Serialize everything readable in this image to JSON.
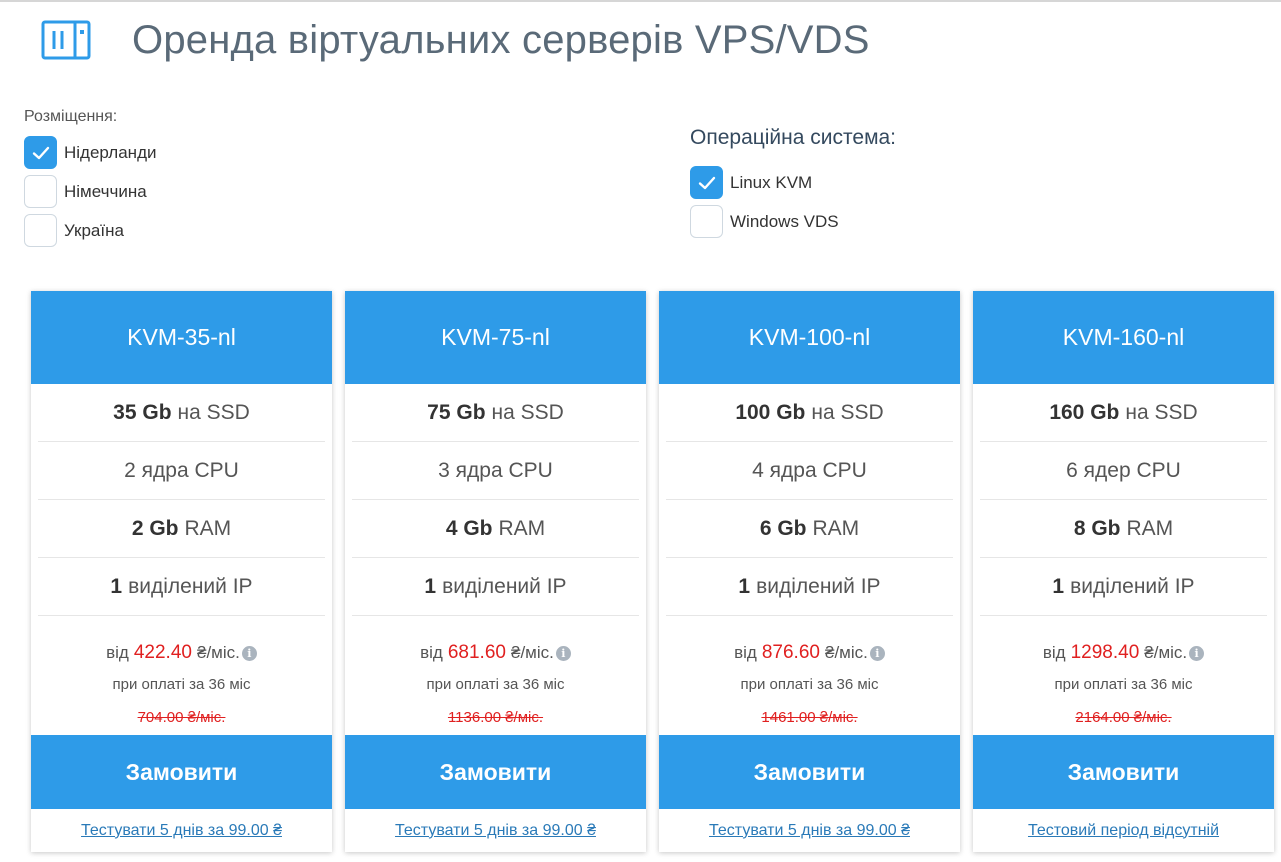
{
  "page": {
    "title": "Оренда віртуальних серверів VPS/VDS",
    "icon": "server-icon",
    "accent_color": "#2e9be8",
    "price_color": "#e02020"
  },
  "location_filter": {
    "title": "Розміщення:",
    "options": [
      {
        "label": "Нідерланди",
        "checked": true
      },
      {
        "label": "Німеччина",
        "checked": false
      },
      {
        "label": "Україна",
        "checked": false
      }
    ]
  },
  "os_filter": {
    "title": "Операційна система:",
    "options": [
      {
        "label": "Linux KVM",
        "checked": true
      },
      {
        "label": "Windows VDS",
        "checked": false
      }
    ]
  },
  "plans": [
    {
      "name": "KVM-35-nl",
      "ssd_value": "35 Gb",
      "ssd_unit": "на SSD",
      "cpu": "2 ядра CPU",
      "ram_value": "2 Gb",
      "ram_unit": "RAM",
      "ip_value": "1",
      "ip_unit": "виділений IP",
      "price_prefix": "від",
      "price": "422.40",
      "price_unit": "₴/міс.",
      "price_note": "при оплаті за 36 міс",
      "old_price": "704.00 ₴/міс.",
      "order_label": "Замовити",
      "test_label": "Тестувати 5 днів за 99.00 ₴"
    },
    {
      "name": "KVM-75-nl",
      "ssd_value": "75 Gb",
      "ssd_unit": "на SSD",
      "cpu": "3 ядра CPU",
      "ram_value": "4 Gb",
      "ram_unit": "RAM",
      "ip_value": "1",
      "ip_unit": "виділений IP",
      "price_prefix": "від",
      "price": "681.60",
      "price_unit": "₴/міс.",
      "price_note": "при оплаті за 36 міс",
      "old_price": "1136.00 ₴/міс.",
      "order_label": "Замовити",
      "test_label": "Тестувати 5 днів за 99.00 ₴"
    },
    {
      "name": "KVM-100-nl",
      "ssd_value": "100 Gb",
      "ssd_unit": "на SSD",
      "cpu": "4 ядра CPU",
      "ram_value": "6 Gb",
      "ram_unit": "RAM",
      "ip_value": "1",
      "ip_unit": "виділений IP",
      "price_prefix": "від",
      "price": "876.60",
      "price_unit": "₴/міс.",
      "price_note": "при оплаті за 36 міс",
      "old_price": "1461.00 ₴/міс.",
      "order_label": "Замовити",
      "test_label": "Тестувати 5 днів за 99.00 ₴"
    },
    {
      "name": "KVM-160-nl",
      "ssd_value": "160 Gb",
      "ssd_unit": "на SSD",
      "cpu": "6 ядер CPU",
      "ram_value": "8 Gb",
      "ram_unit": "RAM",
      "ip_value": "1",
      "ip_unit": "виділений IP",
      "price_prefix": "від",
      "price": "1298.40",
      "price_unit": "₴/міс.",
      "price_note": "при оплаті за 36 міс",
      "old_price": "2164.00 ₴/міс.",
      "order_label": "Замовити",
      "test_label": "Тестовий період відсутній"
    }
  ]
}
